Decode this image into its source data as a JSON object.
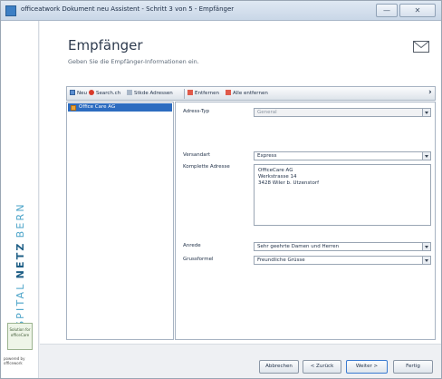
{
  "window": {
    "title": "officeatwork Dokument neu Assistent - Schritt 3 von 5 - Empfänger",
    "min_glyph": "—",
    "close_glyph": "✕"
  },
  "sidebar": {
    "brand_light": "SPITAL",
    "brand_bold": "NETZ",
    "brand_end": "BERN",
    "seal_text": "Solution for officeCare",
    "powered_by": "powered by officework"
  },
  "header": {
    "title": "Empfänger",
    "subtitle": "Geben Sie die Empfänger-Informationen ein.",
    "icon": "envelope-icon"
  },
  "toolbar": {
    "new_label": "Neu",
    "search_label": "Search.ch",
    "local_label": "Stkde Adressen",
    "remove_label": "Entfernen",
    "remove_all_label": "Alle entfernen",
    "more_glyph": "›"
  },
  "recipients": {
    "items": [
      {
        "label": "Office Care AG"
      }
    ]
  },
  "form": {
    "address_type_label": "Adress-Typ",
    "address_type_value": "General",
    "shipping_label": "Versandart",
    "shipping_value": "Express",
    "full_address_label": "Komplette Adresse",
    "address_lines": [
      "OfficeCare AG",
      "Werkstrasse 14",
      "3428 Wiler b. Utzenstorf"
    ],
    "salutation_label": "Anrede",
    "salutation_value": "Sehr geehrte Damen und Herren",
    "closing_label": "Grussformel",
    "closing_value": "Freundliche Grüsse"
  },
  "footer": {
    "cancel_label": "Abbrechen",
    "back_label": "< Zurück",
    "next_label": "Weiter >",
    "finish_label": "Fertig"
  },
  "colors": {
    "selection": "#2d6cc0",
    "brand": "#4aa3c8",
    "brand_bold": "#1f5f86"
  }
}
